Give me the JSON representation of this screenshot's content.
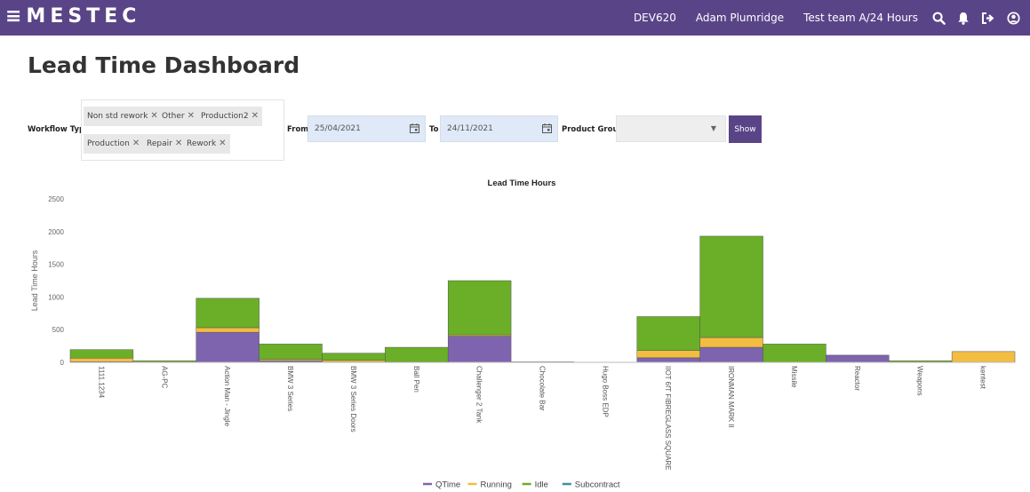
{
  "header": {
    "logo": "≡MESTEC",
    "server": "DEV620",
    "user": "Adam Plumridge",
    "team": "Test team A/24 Hours",
    "icons": [
      "search-icon",
      "bell-icon",
      "logout-icon",
      "user-icon"
    ],
    "brand_color": "#5a4488"
  },
  "page": {
    "title": "Lead Time Dashboard"
  },
  "filters": {
    "workflow_label": "Workflow Type",
    "workflow_tags": [
      "Non std rework",
      "Other",
      "Production2",
      "Production",
      "Repair",
      "Rework"
    ],
    "from_label": "From",
    "from_value": "25/04/2021",
    "to_label": "To",
    "to_value": "24/11/2021",
    "product_group_label": "Product Group",
    "product_group_value": "",
    "show_label": "Show"
  },
  "chart_data": {
    "type": "bar",
    "stacked": true,
    "title": "Lead Time Hours",
    "ylabel": "Lead Time Hours",
    "xlabel": "",
    "ylim": [
      0,
      2500
    ],
    "yticks": [
      0,
      500,
      1000,
      1500,
      2000,
      2500
    ],
    "grid": false,
    "legend": "bottom",
    "categories": [
      "1111.1234",
      "AG-PC",
      "Action Man - Jingle",
      "BMW 3 Series",
      "BMW 3 Series Doors",
      "Ball Pen",
      "Challenger 2 Tank",
      "Chocolate Bar",
      "Hugo Boss EDP",
      "IIOT 6fT FIBREGLASS SQUARE",
      "IRONMAN MARK II",
      "Missile",
      "Reactor",
      "Weapons",
      "kentest"
    ],
    "series": [
      {
        "name": "QTime",
        "color": "#7e64ae",
        "values": [
          10,
          3,
          460,
          25,
          5,
          0,
          400,
          0,
          0,
          70,
          230,
          0,
          110,
          0,
          0
        ]
      },
      {
        "name": "Running",
        "color": "#f3bd42",
        "values": [
          55,
          2,
          70,
          20,
          25,
          5,
          20,
          8,
          3,
          110,
          150,
          0,
          0,
          5,
          165
        ]
      },
      {
        "name": "Idle",
        "color": "#6aaf27",
        "values": [
          130,
          20,
          450,
          235,
          110,
          225,
          830,
          0,
          0,
          520,
          1550,
          280,
          0,
          20,
          0
        ]
      },
      {
        "name": "Subcontract",
        "color": "#3d8fa8",
        "values": [
          0,
          0,
          0,
          0,
          0,
          0,
          0,
          0,
          0,
          0,
          0,
          0,
          0,
          0,
          0
        ]
      }
    ]
  }
}
